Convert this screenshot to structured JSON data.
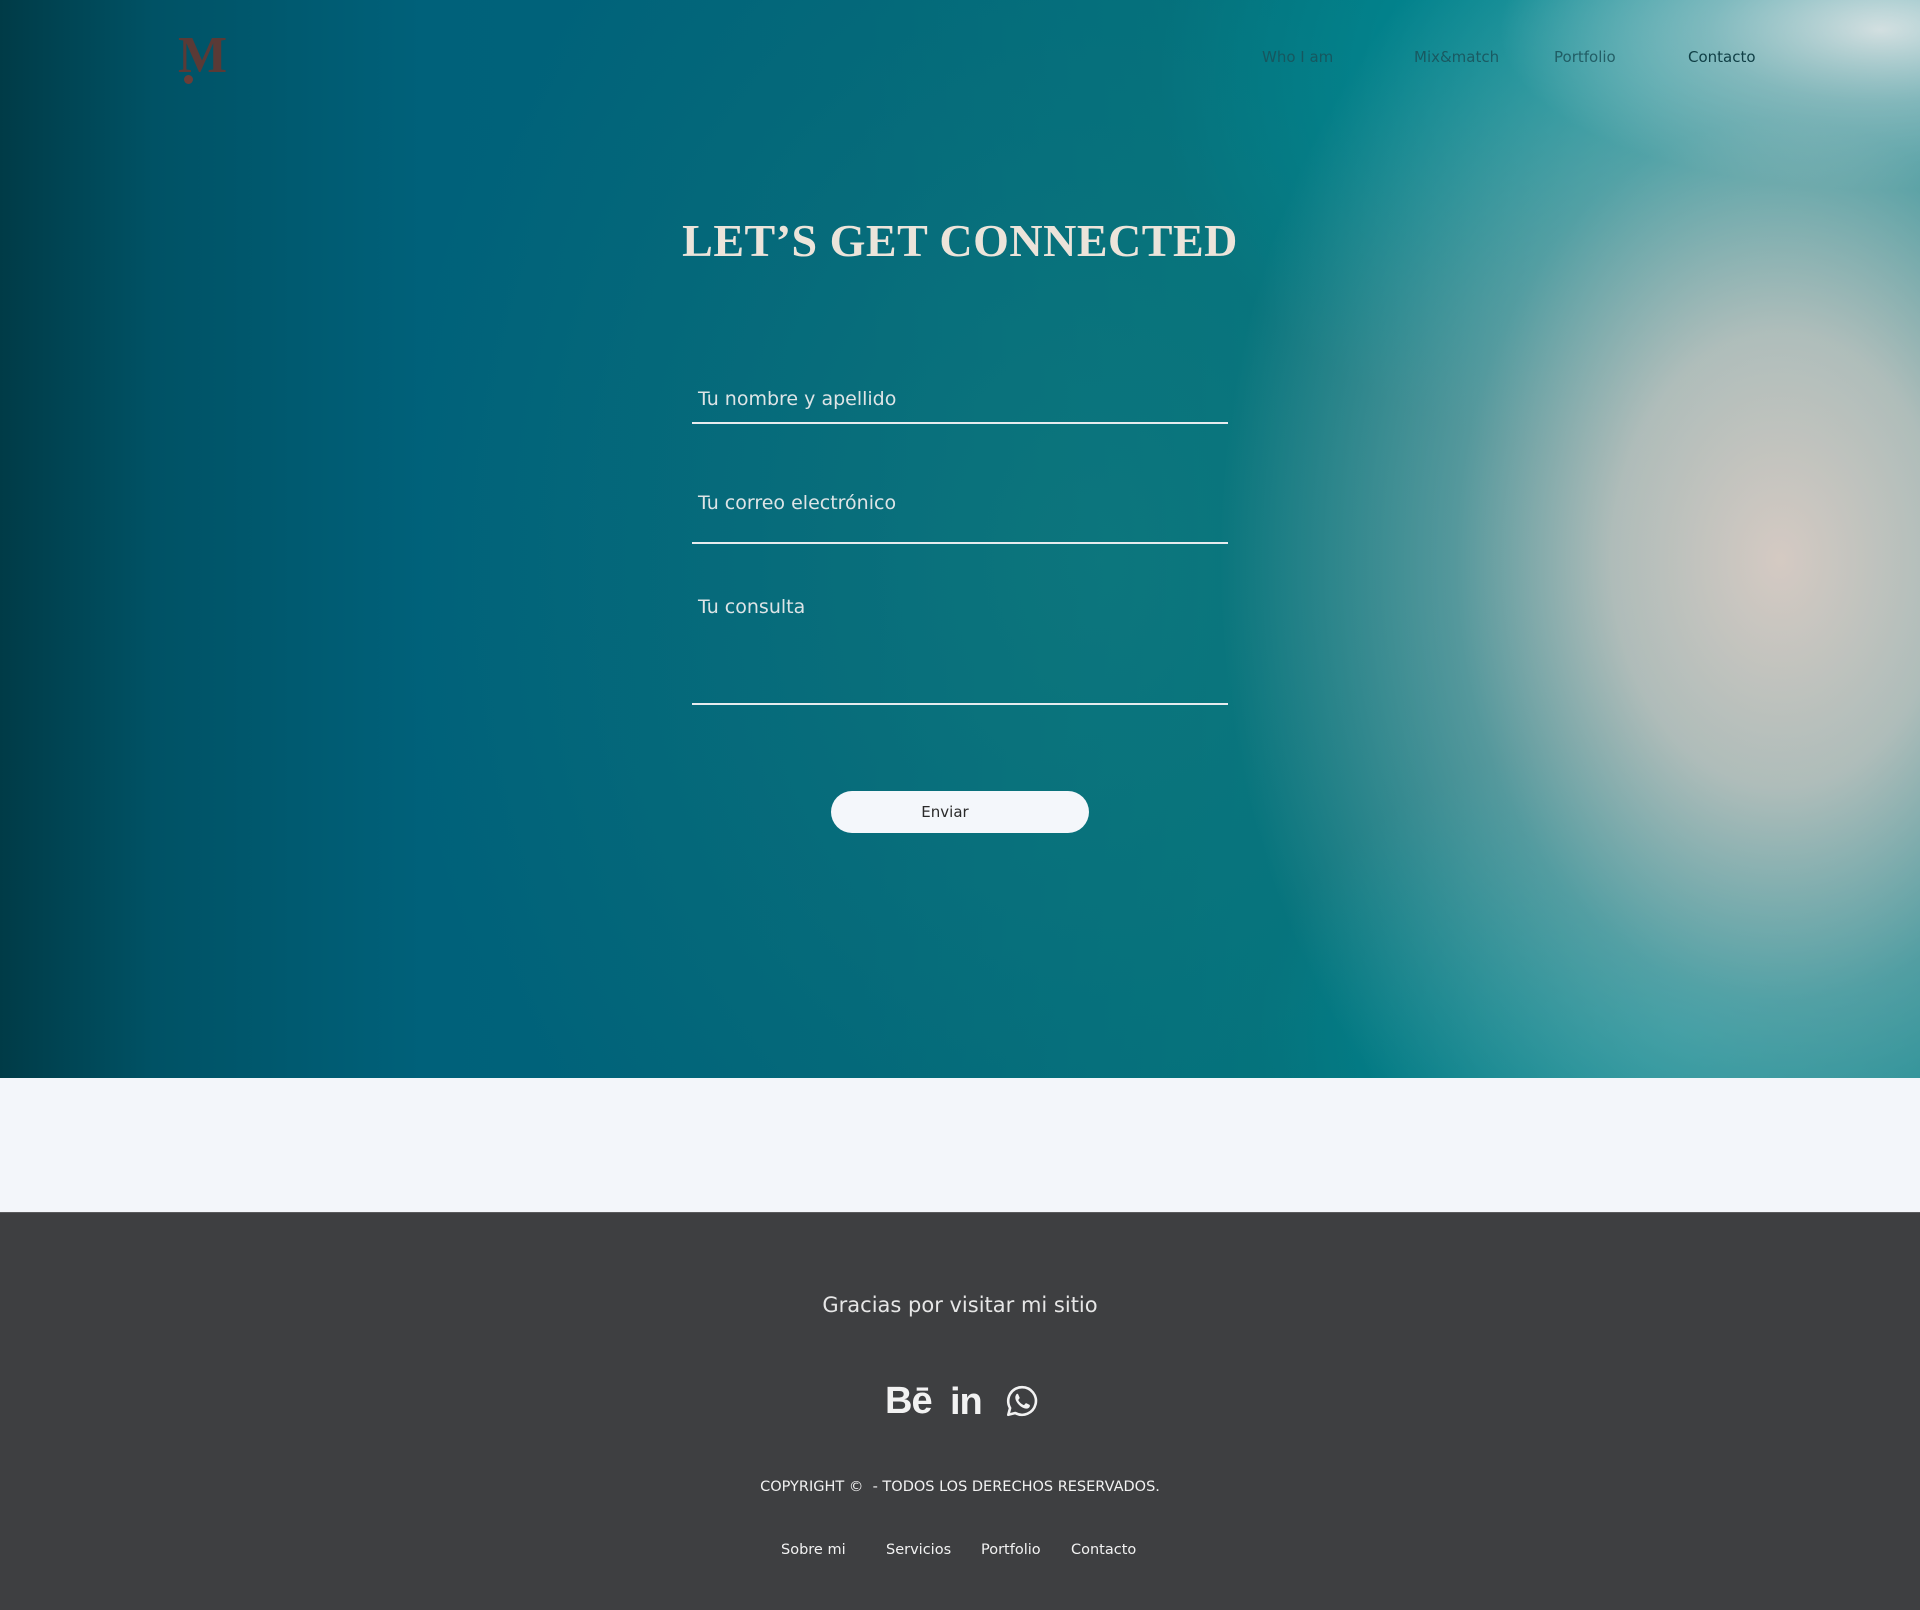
{
  "colors": {
    "hero_teal": "#006479",
    "title_cream": "#ece4da",
    "footer_bg": "#3e3f41",
    "page_bg": "#f3f6fa",
    "button_bg": "#f4f7fb",
    "logo": "#5a3a36"
  },
  "header": {
    "logo_text": "M",
    "nav": [
      "Who I am",
      "Mix&match",
      "Portfolio",
      "Contacto"
    ]
  },
  "contact": {
    "title": "LET’S GET CONNECTED",
    "name_placeholder": "Tu nombre y apellido",
    "email_placeholder": "Tu correo electrónico",
    "message_placeholder": "Tu consulta",
    "submit_label": "Enviar"
  },
  "footer": {
    "thanks": "Gracias por visitar mi sitio",
    "socials": [
      {
        "icon": "behance-icon",
        "glyph": "Bē"
      },
      {
        "icon": "linkedin-icon",
        "glyph": "in"
      },
      {
        "icon": "whatsapp-icon",
        "glyph": ""
      }
    ],
    "copyright": "COPYRIGHT ©  - TODOS LOS DERECHOS RESERVADOS.",
    "links": [
      "Sobre mi",
      "Servicios",
      "Portfolio",
      "Contacto"
    ]
  }
}
